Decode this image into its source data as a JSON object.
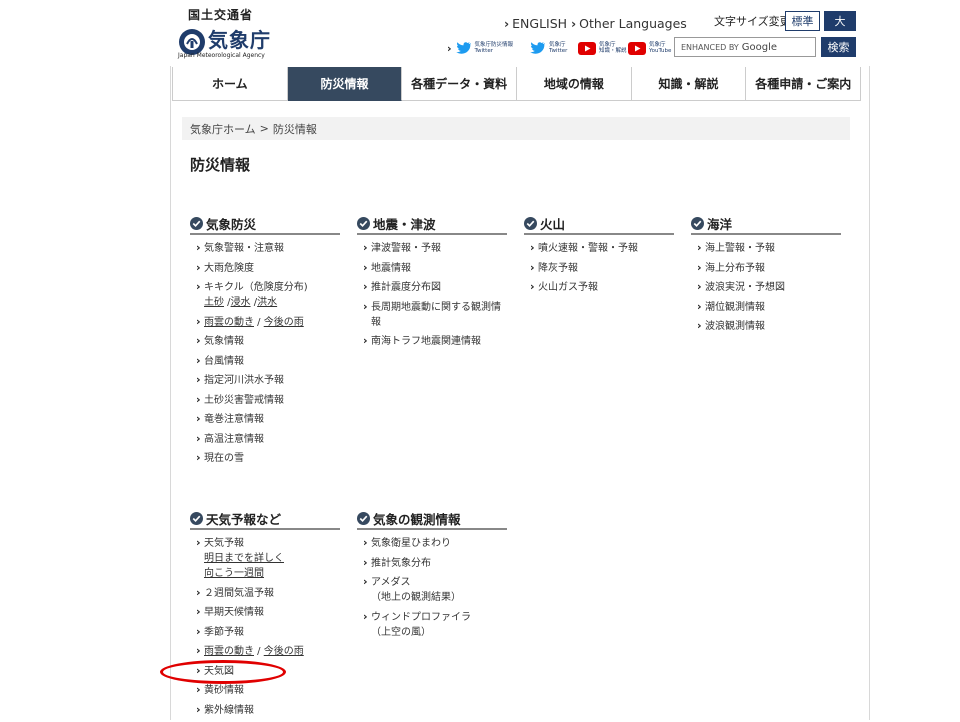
{
  "header": {
    "logo": {
      "ministry": "国土交通省",
      "agency": "気象庁",
      "agency_en": "Japan Meteorological Agency"
    },
    "lang_links": [
      {
        "label": "ENGLISH"
      },
      {
        "label": "Other Languages"
      }
    ],
    "font_size": {
      "label": "文字サイズ変更",
      "standard": "標準",
      "large": "大"
    },
    "sns": [
      {
        "icon": "twitter-icon",
        "caption_1": "気象庁防災情報",
        "caption_2": "Twitter"
      },
      {
        "icon": "twitter-icon",
        "caption_1": "気象庁",
        "caption_2": "Twitter"
      },
      {
        "icon": "youtube-icon",
        "caption_1": "気象庁",
        "caption_2": "知識・解説"
      },
      {
        "icon": "youtube-icon",
        "caption_1": "気象庁",
        "caption_2": "YouTube"
      }
    ],
    "search": {
      "placeholder_prefix": "ENHANCED BY",
      "placeholder_brand": "Google",
      "button": "検索"
    }
  },
  "nav": {
    "tabs": [
      {
        "label": "ホーム",
        "active": false
      },
      {
        "label": "防災情報",
        "active": true
      },
      {
        "label": "各種データ・資料",
        "active": false
      },
      {
        "label": "地域の情報",
        "active": false
      },
      {
        "label": "知識・解説",
        "active": false
      },
      {
        "label": "各種申請・ご案内",
        "active": false
      }
    ]
  },
  "breadcrumb": {
    "home": "気象庁ホーム",
    "separator": ">",
    "current": "防災情報"
  },
  "page_title": "防災情報",
  "sections": {
    "kisho_bousai": {
      "title": "気象防災",
      "items": [
        {
          "label": "気象警報・注意報"
        },
        {
          "label": "大雨危険度"
        },
        {
          "label": "キキクル（危険度分布)",
          "subs": [
            "土砂",
            "浸水",
            "洪水"
          ]
        },
        {
          "links": [
            "雨雲の動き",
            "今後の雨"
          ]
        },
        {
          "label": "気象情報"
        },
        {
          "label": "台風情報"
        },
        {
          "label": "指定河川洪水予報"
        },
        {
          "label": "土砂災害警戒情報"
        },
        {
          "label": "竜巻注意情報"
        },
        {
          "label": "高温注意情報"
        },
        {
          "label": "現在の雪"
        }
      ]
    },
    "jishin": {
      "title": "地震・津波",
      "items": [
        {
          "label": "津波警報・予報"
        },
        {
          "label": "地震情報"
        },
        {
          "label": "推計震度分布図"
        },
        {
          "label": "長周期地震動に関する観測情報"
        },
        {
          "label": "南海トラフ地震関連情報"
        }
      ]
    },
    "kazan": {
      "title": "火山",
      "items": [
        {
          "label": "噴火速報・警報・予報"
        },
        {
          "label": "降灰予報"
        },
        {
          "label": "火山ガス予報"
        }
      ]
    },
    "kaiyo": {
      "title": "海洋",
      "items": [
        {
          "label": "海上警報・予報"
        },
        {
          "label": "海上分布予報"
        },
        {
          "label": "波浪実況・予想図"
        },
        {
          "label": "潮位観測情報"
        },
        {
          "label": "波浪観測情報"
        }
      ]
    },
    "tenki": {
      "title": "天気予報など",
      "items": [
        {
          "label": "天気予報",
          "sub1": "明日までを詳しく",
          "sub2": "向こう一週間"
        },
        {
          "label": "２週間気温予報"
        },
        {
          "label": "早期天候情報"
        },
        {
          "label": "季節予報"
        },
        {
          "links": [
            "雨雲の動き",
            "今後の雨"
          ]
        },
        {
          "label": "天気図"
        },
        {
          "label": "黄砂情報"
        },
        {
          "label": "紫外線情報"
        }
      ]
    },
    "kansoku": {
      "title": "気象の観測情報",
      "items": [
        {
          "label": "気象衛星ひまわり"
        },
        {
          "label": "推計気象分布"
        },
        {
          "label": "アメダス",
          "sub1": "（地上の観測結果）"
        },
        {
          "label": "ウィンドプロファイラ",
          "sub1": "（上空の風）"
        }
      ]
    }
  },
  "annotation_color": "#e00000"
}
